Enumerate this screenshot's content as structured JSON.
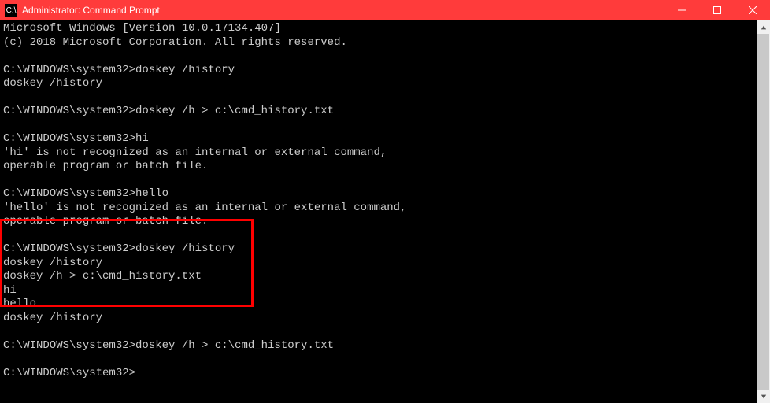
{
  "titlebar": {
    "title": "Administrator: Command Prompt",
    "icon_glyph": "C:\\"
  },
  "terminal": {
    "lines": [
      "Microsoft Windows [Version 10.0.17134.407]",
      "(c) 2018 Microsoft Corporation. All rights reserved.",
      "",
      "C:\\WINDOWS\\system32>doskey /history",
      "doskey /history",
      "",
      "C:\\WINDOWS\\system32>doskey /h > c:\\cmd_history.txt",
      "",
      "C:\\WINDOWS\\system32>hi",
      "'hi' is not recognized as an internal or external command,",
      "operable program or batch file.",
      "",
      "C:\\WINDOWS\\system32>hello",
      "'hello' is not recognized as an internal or external command,",
      "operable program or batch file.",
      "",
      "C:\\WINDOWS\\system32>doskey /history",
      "doskey /history",
      "doskey /h > c:\\cmd_history.txt",
      "hi",
      "hello",
      "doskey /history",
      "",
      "C:\\WINDOWS\\system32>doskey /h > c:\\cmd_history.txt",
      "",
      "C:\\WINDOWS\\system32>"
    ]
  }
}
